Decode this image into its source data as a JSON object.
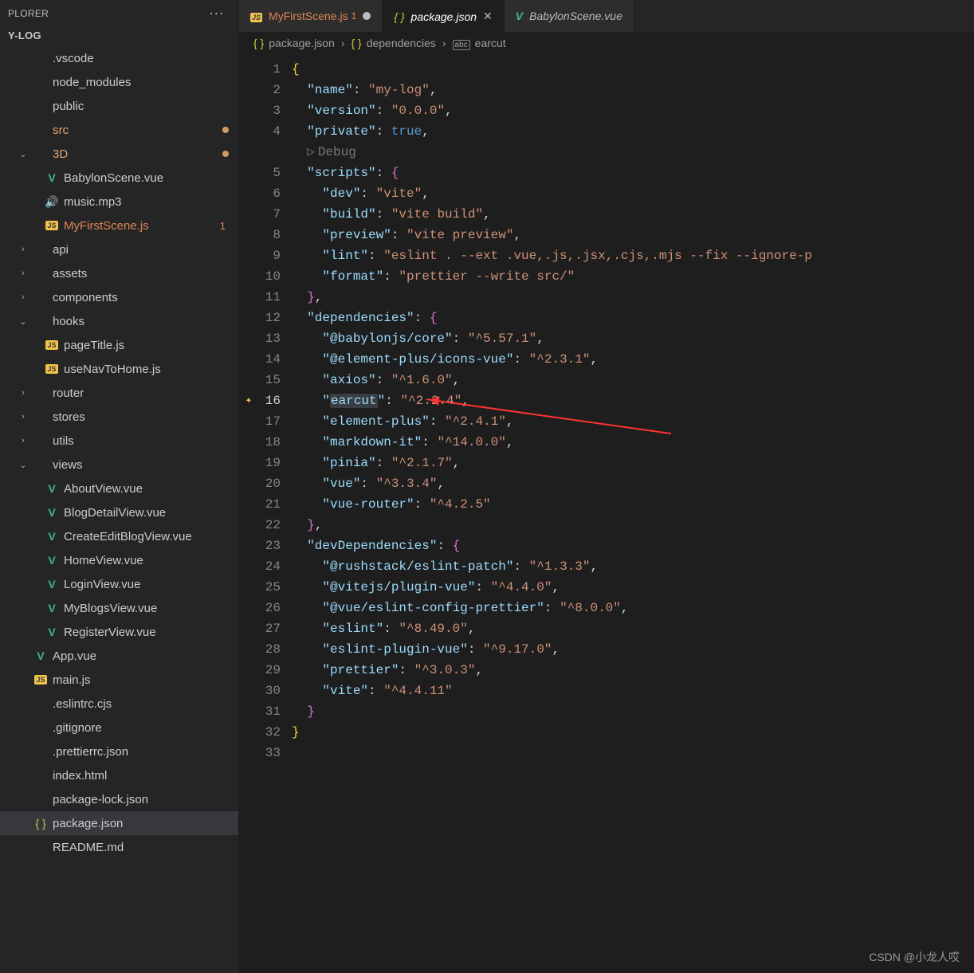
{
  "explorer": {
    "label": "PLORER",
    "project": "Y-LOG"
  },
  "tree": [
    {
      "c": "",
      "i": "",
      "t": ".vscode",
      "d": 1
    },
    {
      "c": "",
      "i": "",
      "t": "node_modules",
      "d": 1
    },
    {
      "c": "",
      "i": "",
      "t": "public",
      "d": 1
    },
    {
      "c": "",
      "i": "",
      "t": "src",
      "d": 1,
      "cls": "orange",
      "dot": true
    },
    {
      "c": "v",
      "i": "",
      "t": "3D",
      "d": 1,
      "cls": "orange",
      "dot": true
    },
    {
      "c": "",
      "i": "v",
      "t": "BabylonScene.vue",
      "d": 2
    },
    {
      "c": "",
      "i": "aud",
      "t": "music.mp3",
      "d": 2
    },
    {
      "c": "",
      "i": "js",
      "t": "MyFirstScene.js",
      "d": 2,
      "cls": "orange-bright",
      "err": "1"
    },
    {
      "c": ">",
      "i": "",
      "t": "api",
      "d": 1
    },
    {
      "c": ">",
      "i": "",
      "t": "assets",
      "d": 1
    },
    {
      "c": ">",
      "i": "",
      "t": "components",
      "d": 1
    },
    {
      "c": "v",
      "i": "",
      "t": "hooks",
      "d": 1
    },
    {
      "c": "",
      "i": "js",
      "t": "pageTitle.js",
      "d": 2
    },
    {
      "c": "",
      "i": "js",
      "t": "useNavToHome.js",
      "d": 2
    },
    {
      "c": ">",
      "i": "",
      "t": "router",
      "d": 1
    },
    {
      "c": ">",
      "i": "",
      "t": "stores",
      "d": 1
    },
    {
      "c": ">",
      "i": "",
      "t": "utils",
      "d": 1
    },
    {
      "c": "v",
      "i": "",
      "t": "views",
      "d": 1
    },
    {
      "c": "",
      "i": "v",
      "t": "AboutView.vue",
      "d": 2
    },
    {
      "c": "",
      "i": "v",
      "t": "BlogDetailView.vue",
      "d": 2
    },
    {
      "c": "",
      "i": "v",
      "t": "CreateEditBlogView.vue",
      "d": 2
    },
    {
      "c": "",
      "i": "v",
      "t": "HomeView.vue",
      "d": 2
    },
    {
      "c": "",
      "i": "v",
      "t": "LoginView.vue",
      "d": 2
    },
    {
      "c": "",
      "i": "v",
      "t": "MyBlogsView.vue",
      "d": 2
    },
    {
      "c": "",
      "i": "v",
      "t": "RegisterView.vue",
      "d": 2
    },
    {
      "c": "",
      "i": "v",
      "t": "App.vue",
      "d": 1
    },
    {
      "c": "",
      "i": "js",
      "t": "main.js",
      "d": 1,
      "jsY": true
    },
    {
      "c": "",
      "i": "",
      "t": ".eslintrc.cjs",
      "d": 1
    },
    {
      "c": "",
      "i": "",
      "t": ".gitignore",
      "d": 1
    },
    {
      "c": "",
      "i": "",
      "t": ".prettierrc.json",
      "d": 1
    },
    {
      "c": "",
      "i": "",
      "t": "index.html",
      "d": 1
    },
    {
      "c": "",
      "i": "",
      "t": "package-lock.json",
      "d": 1
    },
    {
      "c": "",
      "i": "braces",
      "t": "package.json",
      "d": 1,
      "sel": true
    },
    {
      "c": "",
      "i": "",
      "t": "README.md",
      "d": 1
    }
  ],
  "tabs": [
    {
      "icon": "js",
      "label": "MyFirstScene.js",
      "badge": "1",
      "dirty": true,
      "cls": "orange"
    },
    {
      "icon": "braces",
      "label": "package.json",
      "active": true,
      "close": true
    },
    {
      "icon": "v",
      "label": "BabylonScene.vue"
    }
  ],
  "breadcrumbs": [
    {
      "icon": "braces",
      "t": "package.json"
    },
    {
      "icon": "braces",
      "t": "dependencies"
    },
    {
      "icon": "abc",
      "t": "earcut"
    }
  ],
  "chart_data": {
    "type": "table",
    "title": "package.json",
    "name": "my-log",
    "version": "0.0.0",
    "private": true,
    "scripts": {
      "dev": "vite",
      "build": "vite build",
      "preview": "vite preview",
      "lint": "eslint . --ext .vue,.js,.jsx,.cjs,.mjs --fix --ignore-p",
      "format": "prettier --write src/"
    },
    "dependencies": {
      "@babylonjs/core": "^5.57.1",
      "@element-plus/icons-vue": "^2.3.1",
      "axios": "^1.6.0",
      "earcut": "^2.2.4",
      "element-plus": "^2.4.1",
      "markdown-it": "^14.0.0",
      "pinia": "^2.1.7",
      "vue": "^3.3.4",
      "vue-router": "^4.2.5"
    },
    "devDependencies": {
      "@rushstack/eslint-patch": "^1.3.3",
      "@vitejs/plugin-vue": "^4.4.0",
      "@vue/eslint-config-prettier": "^8.0.0",
      "eslint": "^8.49.0",
      "eslint-plugin-vue": "^9.17.0",
      "prettier": "^3.0.3",
      "vite": "^4.4.11"
    }
  },
  "debugLabel": "Debug",
  "lines": [
    {
      "n": 1,
      "html": "<span class='by'>{</span>"
    },
    {
      "n": 2,
      "html": "  <span class='k'>\"name\"</span>: <span class='s'>\"my-log\"</span>,"
    },
    {
      "n": 3,
      "html": "  <span class='k'>\"version\"</span>: <span class='s'>\"0.0.0\"</span>,"
    },
    {
      "n": 4,
      "html": "  <span class='k'>\"private\"</span>: <span class='b'>true</span>,"
    },
    {
      "n": "D",
      "html": "  <span class='debug'><span class='tri'>▷</span>Debug</span>"
    },
    {
      "n": 5,
      "html": "  <span class='k'>\"scripts\"</span>: <span class='bp'>{</span>"
    },
    {
      "n": 6,
      "html": "    <span class='k'>\"dev\"</span>: <span class='s'>\"vite\"</span>,"
    },
    {
      "n": 7,
      "html": "    <span class='k'>\"build\"</span>: <span class='s'>\"vite build\"</span>,"
    },
    {
      "n": 8,
      "html": "    <span class='k'>\"preview\"</span>: <span class='s'>\"vite preview\"</span>,"
    },
    {
      "n": 9,
      "html": "    <span class='k'>\"lint\"</span>: <span class='s'>\"eslint . --ext .vue,.js,.jsx,.cjs,.mjs --fix --ignore-p</span>"
    },
    {
      "n": 10,
      "html": "    <span class='k'>\"format\"</span>: <span class='s'>\"prettier --write src/\"</span>"
    },
    {
      "n": 11,
      "html": "  <span class='bp'>}</span>,"
    },
    {
      "n": 12,
      "html": "  <span class='k'>\"dependencies\"</span>: <span class='bp'>{</span>"
    },
    {
      "n": 13,
      "html": "    <span class='k'>\"@babylonjs/core\"</span>: <span class='s'>\"^5.57.1\"</span>,"
    },
    {
      "n": 14,
      "html": "    <span class='k'>\"@element-plus/icons-vue\"</span>: <span class='s'>\"^2.3.1\"</span>,"
    },
    {
      "n": 15,
      "html": "    <span class='k'>\"axios\"</span>: <span class='s'>\"^1.6.0\"</span>,"
    },
    {
      "n": 16,
      "cur": true,
      "gly": "✦",
      "html": "    <span class='k'>\"<span class='hl'>earcut</span>\"</span>: <span class='s'>\"^2.2.4\"</span>,"
    },
    {
      "n": 17,
      "html": "    <span class='k'>\"element-plus\"</span>: <span class='s'>\"^2.4.1\"</span>,"
    },
    {
      "n": 18,
      "html": "    <span class='k'>\"markdown-it\"</span>: <span class='s'>\"^14.0.0\"</span>,"
    },
    {
      "n": 19,
      "html": "    <span class='k'>\"pinia\"</span>: <span class='s'>\"^2.1.7\"</span>,"
    },
    {
      "n": 20,
      "html": "    <span class='k'>\"vue\"</span>: <span class='s'>\"^3.3.4\"</span>,"
    },
    {
      "n": 21,
      "html": "    <span class='k'>\"vue-router\"</span>: <span class='s'>\"^4.2.5\"</span>"
    },
    {
      "n": 22,
      "html": "  <span class='bp'>}</span>,"
    },
    {
      "n": 23,
      "html": "  <span class='k'>\"devDependencies\"</span>: <span class='bp'>{</span>"
    },
    {
      "n": 24,
      "html": "    <span class='k'>\"@rushstack/eslint-patch\"</span>: <span class='s'>\"^1.3.3\"</span>,"
    },
    {
      "n": 25,
      "html": "    <span class='k'>\"@vitejs/plugin-vue\"</span>: <span class='s'>\"^4.4.0\"</span>,"
    },
    {
      "n": 26,
      "html": "    <span class='k'>\"@vue/eslint-config-prettier\"</span>: <span class='s'>\"^8.0.0\"</span>,"
    },
    {
      "n": 27,
      "html": "    <span class='k'>\"eslint\"</span>: <span class='s'>\"^8.49.0\"</span>,"
    },
    {
      "n": 28,
      "html": "    <span class='k'>\"eslint-plugin-vue\"</span>: <span class='s'>\"^9.17.0\"</span>,"
    },
    {
      "n": 29,
      "html": "    <span class='k'>\"prettier\"</span>: <span class='s'>\"^3.0.3\"</span>,"
    },
    {
      "n": 30,
      "html": "    <span class='k'>\"vite\"</span>: <span class='s'>\"^4.4.11\"</span>"
    },
    {
      "n": 31,
      "html": "  <span class='bp'>}</span>"
    },
    {
      "n": 32,
      "html": "<span class='by'>}</span>"
    },
    {
      "n": 33,
      "html": ""
    }
  ],
  "watermark": "CSDN @小龙人哎"
}
